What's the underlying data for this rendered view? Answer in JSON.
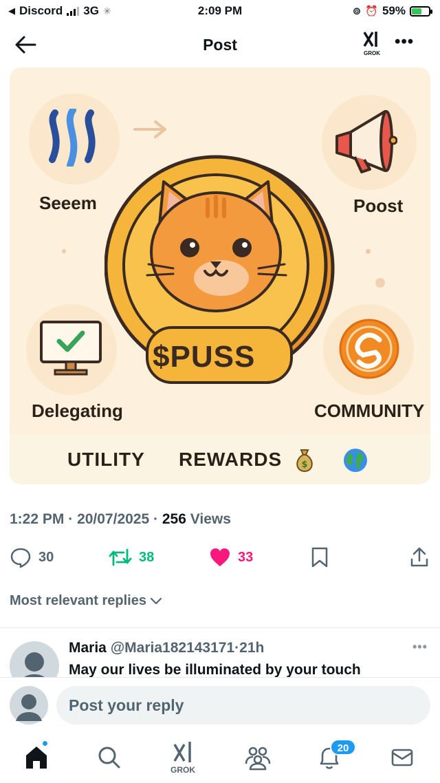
{
  "status_bar": {
    "back_app": "Discord",
    "network": "3G",
    "time": "2:09 PM",
    "battery_percent": "59%",
    "battery_level": 0.59
  },
  "header": {
    "title": "Post",
    "grok_label": "GROK"
  },
  "post_image": {
    "labels": {
      "top_left": "Seeem",
      "top_right": "Poost",
      "bottom_left": "Delegating",
      "bottom_right": "COMMUNITY",
      "coin": "$PUSS"
    },
    "band": {
      "utility": "UTILITY",
      "rewards": "REWARDS"
    },
    "icons": [
      "steem-logo-icon",
      "arrow-right-icon",
      "megaphone-icon",
      "cat-coin-icon",
      "monitor-check-icon",
      "community-coin-icon",
      "money-bag-icon",
      "globe-icon"
    ]
  },
  "meta": {
    "time": "1:22 PM",
    "sep": "·",
    "date": "20/07/2025",
    "views_count": "256",
    "views_label": "Views"
  },
  "actions": {
    "replies": "30",
    "reposts": "38",
    "likes": "33"
  },
  "colors": {
    "accent": "#1d9bf0",
    "repost": "#00ba7c",
    "like": "#f91880",
    "secondary_text": "#536471"
  },
  "replies_sort": "Most relevant replies",
  "reply": {
    "name": "Maria",
    "handle": "@Maria182143171",
    "sep": "·",
    "age": "21h",
    "text": "May our lives be illuminated by your touch"
  },
  "compose": {
    "placeholder": "Post your reply"
  },
  "tabbar": {
    "grok_label": "GROK",
    "notifications_badge": "20"
  }
}
